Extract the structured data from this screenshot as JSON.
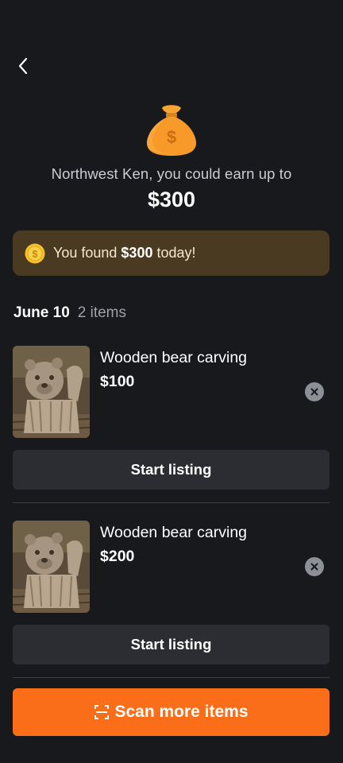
{
  "header": {
    "back_icon": "chevron-left-icon"
  },
  "hero": {
    "icon": "money-bag-icon",
    "message": "Northwest Ken, you could earn up to",
    "amount": "$300"
  },
  "banner": {
    "icon": "coin-icon",
    "prefix": "You found ",
    "amount": "$300",
    "suffix": " today!"
  },
  "group": {
    "date": "June 10",
    "count": "2 items"
  },
  "items": [
    {
      "title": "Wooden bear carving",
      "price": "$100",
      "action_label": "Start listing"
    },
    {
      "title": "Wooden bear carving",
      "price": "$200",
      "action_label": "Start listing"
    }
  ],
  "scan": {
    "label": "Scan more items",
    "icon": "scan-icon"
  },
  "colors": {
    "background": "#18191c",
    "accent": "#fa6e1a",
    "banner_bg": "#4a3a22",
    "card_button": "#2b2d32"
  }
}
